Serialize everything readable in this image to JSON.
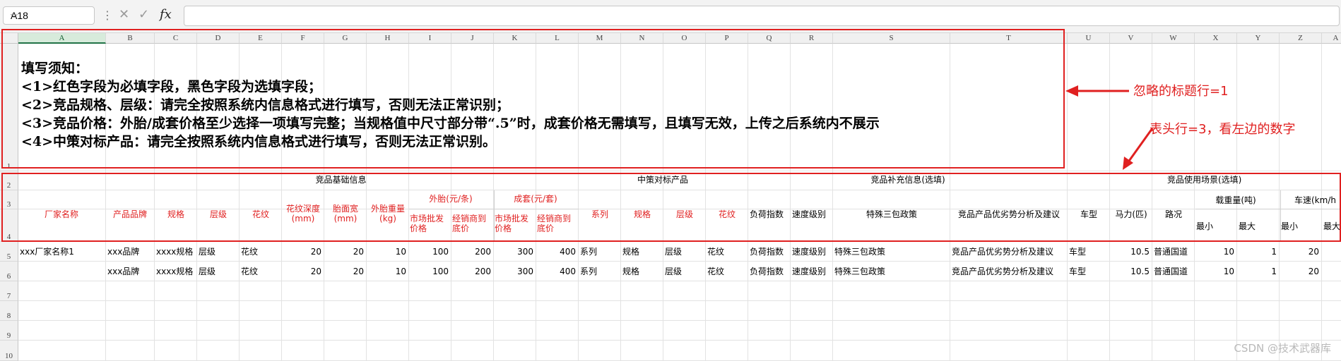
{
  "formula_bar": {
    "name_box": "A18",
    "fx_label": "fx",
    "cancel_icon": "x-icon",
    "confirm_icon": "check-icon",
    "formula": ""
  },
  "columns": [
    "A",
    "B",
    "C",
    "D",
    "E",
    "F",
    "G",
    "H",
    "I",
    "J",
    "K",
    "L",
    "M",
    "N",
    "O",
    "P",
    "Q",
    "R",
    "S",
    "T",
    "U",
    "V",
    "W",
    "X",
    "Y",
    "Z",
    "A"
  ],
  "rows": [
    "1",
    "2",
    "3",
    "4",
    "5",
    "6",
    "7",
    "8",
    "9",
    "10"
  ],
  "notice": [
    "填写须知：",
    "<1>红色字段为必填字段，黑色字段为选填字段；",
    "<2>竞品规格、层级：请完全按照系统内信息格式进行填写，否则无法正常识别；",
    "<3>竞品价格：外胎/成套价格至少选择一项填写完整；当规格值中尺寸部分带“.5”时，成套价格无需填写，且填写无效，上传之后系统内不展示",
    "<4>中策对标产品：请完全按照系统内信息格式进行填写，否则无法正常识别。"
  ],
  "header_groups": {
    "basic": "竞品基础信息",
    "benchmark": "中策对标产品",
    "supplement": "竞品补充信息(选填)",
    "usage": "竞品使用场景(选填)"
  },
  "header_sub": {
    "outer": "外胎(元/条)",
    "set": "成套(元/套)",
    "load": "载重量(吨)",
    "speed": "车速(km/h"
  },
  "header_cols": {
    "maker": "厂家名称",
    "brand": "产品品牌",
    "spec": "规格",
    "level": "层级",
    "pattern": "花纹",
    "depth": "花纹深度(mm)",
    "width": "胎面宽(mm)",
    "weight": "外胎重量(kg)",
    "outer_wholesale": "市场批发价格",
    "outer_dealer": "经销商到底价",
    "set_wholesale": "市场批发价格",
    "set_dealer": "经销商到底价",
    "bm_series": "系列",
    "bm_spec": "规格",
    "bm_level": "层级",
    "bm_pattern": "花纹",
    "load_index": "负荷指数",
    "speed_level": "速度级别",
    "policy": "特殊三包政策",
    "analysis": "竞品产品优劣势分析及建议",
    "vehicle": "车型",
    "power": "马力(匹)",
    "road": "路况",
    "load_min": "最小",
    "load_max": "最大",
    "speed_min": "最小",
    "speed_max": "最大"
  },
  "data_rows": [
    {
      "maker": "xxx厂家名称1",
      "brand": "xxx品牌",
      "spec": "xxxx规格",
      "level": "层级",
      "pattern": "花纹",
      "depth": "20",
      "width": "20",
      "weight": "10",
      "ow": "100",
      "od": "200",
      "sw": "300",
      "sd": "400",
      "series": "系列",
      "bspec": "规格",
      "blevel": "层级",
      "bpattern": "花纹",
      "load_index": "负荷指数",
      "speed_level": "速度级别",
      "policy": "特殊三包政策",
      "analysis": "竞品产品优劣势分析及建议",
      "vehicle": "车型",
      "power": "10.5",
      "road": "普通国道",
      "lmin": "10",
      "lmax": "1",
      "smin": "20"
    },
    {
      "maker": "",
      "brand": "xxx品牌",
      "spec": "xxxx规格",
      "level": "层级",
      "pattern": "花纹",
      "depth": "20",
      "width": "20",
      "weight": "10",
      "ow": "100",
      "od": "200",
      "sw": "300",
      "sd": "400",
      "series": "系列",
      "bspec": "规格",
      "blevel": "层级",
      "bpattern": "花纹",
      "load_index": "负荷指数",
      "speed_level": "速度级别",
      "policy": "特殊三包政策",
      "analysis": "竞品产品优劣势分析及建议",
      "vehicle": "车型",
      "power": "10.5",
      "road": "普通国道",
      "lmin": "10",
      "lmax": "1",
      "smin": "20"
    }
  ],
  "annotations": {
    "ignored_title": "忽略的标题行=1",
    "header_row": "表头行=3，看左边的数字"
  },
  "watermark": "CSDN @技术武器库",
  "colors": {
    "required": "#e02020",
    "accent": "#217346"
  }
}
